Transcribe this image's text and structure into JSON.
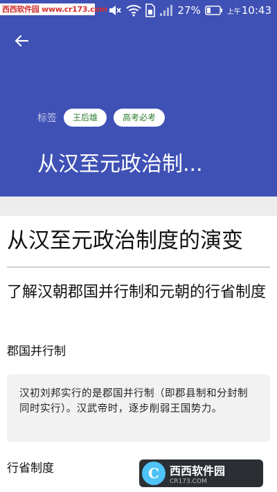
{
  "status_bar": {
    "watermark": "西西软件园 www.cr173.com",
    "battery_percent": "27%",
    "time_prefix": "上午",
    "time": "10:43",
    "icons": [
      "mute-icon",
      "wifi-icon",
      "sim-icon",
      "signal-icon",
      "battery-icon"
    ]
  },
  "header": {
    "back_icon": "arrow-left-icon",
    "tags_label": "标签",
    "tags": [
      "王后雄",
      "高考必考"
    ],
    "title": "从汉至元政治制..."
  },
  "article": {
    "title": "从汉至元政治制度的演变",
    "section_heading": "了解汉朝郡国并行制和元朝的行省制度",
    "sub_heading_1": "郡国并行制",
    "quote": "汉初刘邦实行的是郡国并行制（即郡县制和分封制同时实行）。汉武帝时，逐步削弱王国势力。",
    "sub_heading_2": "行省制度"
  },
  "watermark_bottom": {
    "logo_letter": "C",
    "brand": "西西软件园",
    "url": "CR173.COM"
  },
  "colors": {
    "primary": "#3f51b5",
    "tag_text": "#2e7d32",
    "band": "#ededed",
    "quote_bg": "#f2f2f2"
  }
}
